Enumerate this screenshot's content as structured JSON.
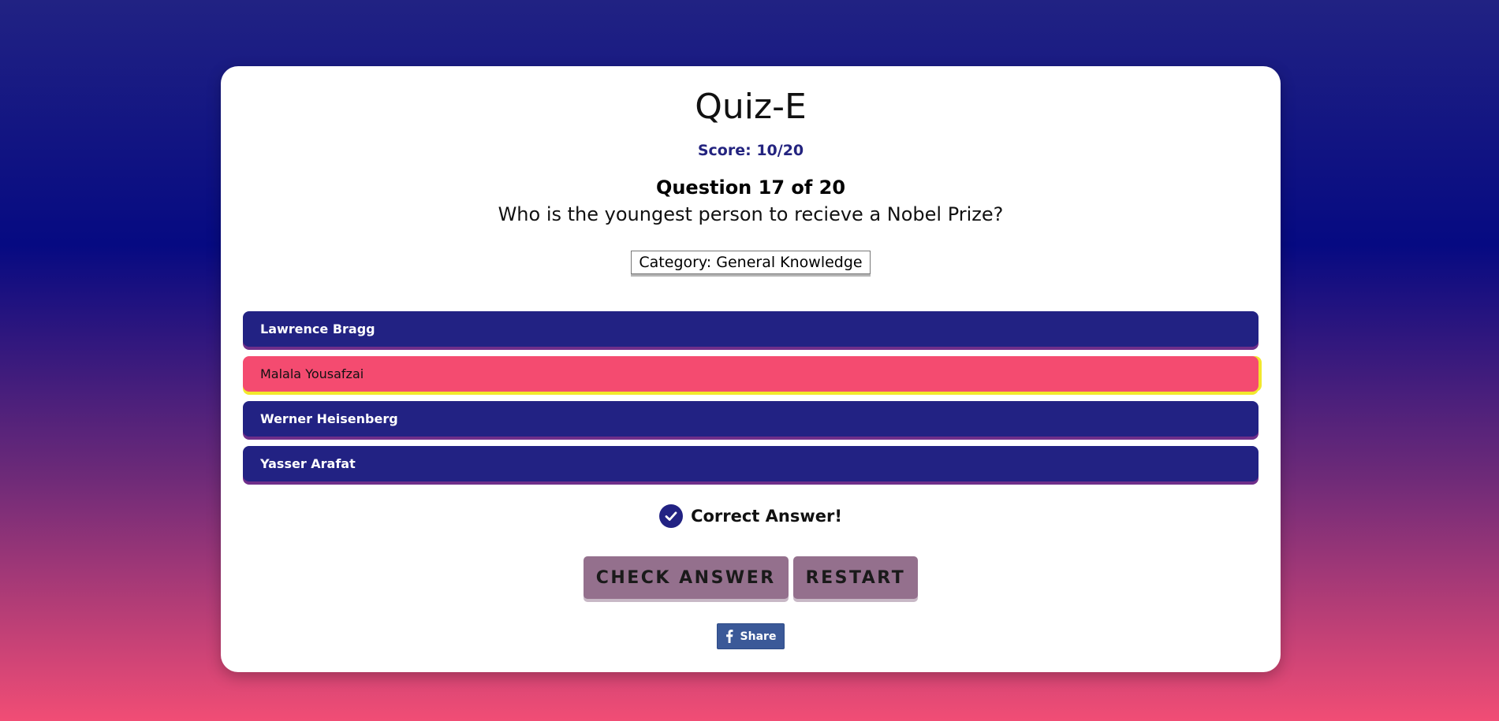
{
  "app": {
    "title": "Quiz-E",
    "score": "Score: 10/20"
  },
  "question": {
    "number": "Question 17 of 20",
    "text": "Who is the youngest person to recieve a Nobel Prize?",
    "category": "Category: General Knowledge"
  },
  "answers": [
    {
      "label": "Lawrence Bragg",
      "selected": false
    },
    {
      "label": "Malala Yousafzai",
      "selected": true
    },
    {
      "label": "Werner Heisenberg",
      "selected": false
    },
    {
      "label": "Yasser Arafat",
      "selected": false
    }
  ],
  "feedback": {
    "text": "Correct Answer!",
    "icon": "check-circle-icon"
  },
  "buttons": {
    "check_answer": "CHECK ANSWER",
    "restart": "RESTART"
  },
  "share": {
    "label": "Share",
    "icon": "facebook-icon"
  },
  "colors": {
    "answer_default": "#222283",
    "answer_selected": "#f44b70",
    "selected_outline": "#f2e82c",
    "button": "#94708d",
    "facebook": "#3b5998"
  }
}
